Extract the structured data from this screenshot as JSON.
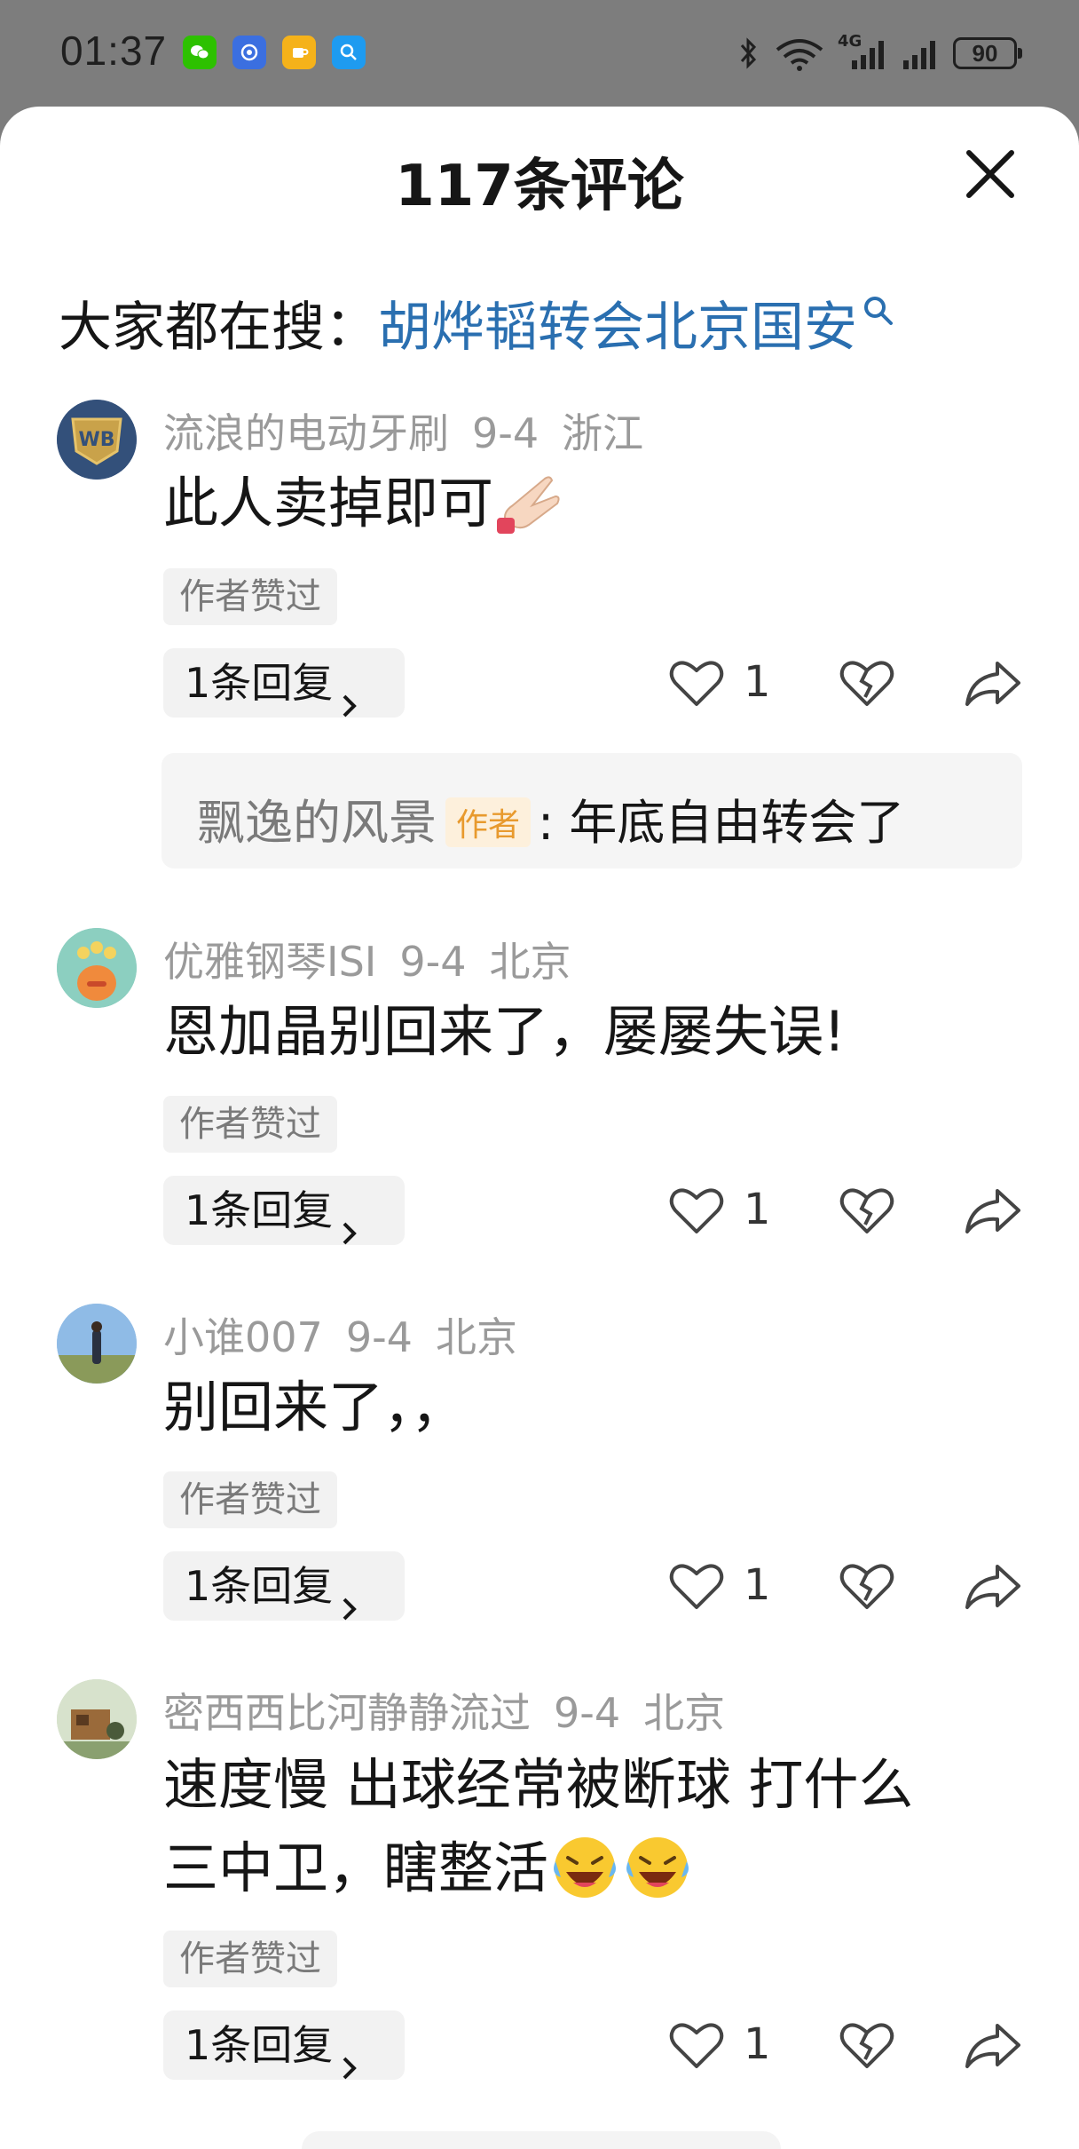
{
  "status_bar": {
    "time": "01:37",
    "network": "4G",
    "battery": "90"
  },
  "header": {
    "title": "117条评论"
  },
  "search": {
    "prefix": "大家都在搜：",
    "keyword": "胡烨韬转会北京国安"
  },
  "comments": [
    {
      "user": "流浪的电动牙刷",
      "date": "9-4",
      "location": "浙江",
      "text": "此人卖掉即可",
      "author_liked": "作者赞过",
      "replies_label": "1条回复",
      "likes": "1",
      "sub_reply": {
        "user": "飘逸的风景",
        "tag": "作者",
        "text": ": 年底自由转会了"
      }
    },
    {
      "user": "优雅钢琴ISI",
      "date": "9-4",
      "location": "北京",
      "text": "恩加晶别回来了，屡屡失误!",
      "author_liked": "作者赞过",
      "replies_label": "1条回复",
      "likes": "1"
    },
    {
      "user": "小谁007",
      "date": "9-4",
      "location": "北京",
      "text": "别回来了，，",
      "author_liked": "作者赞过",
      "replies_label": "1条回复",
      "likes": "1"
    },
    {
      "user": "密西西比河静静流过",
      "date": "9-4",
      "location": "北京",
      "text_line1": "速度慢 出球经常被断球 打什么",
      "text_line2": "三中卫，瞎整活",
      "author_liked": "作者赞过",
      "replies_label": "1条回复",
      "likes": "1"
    }
  ]
}
